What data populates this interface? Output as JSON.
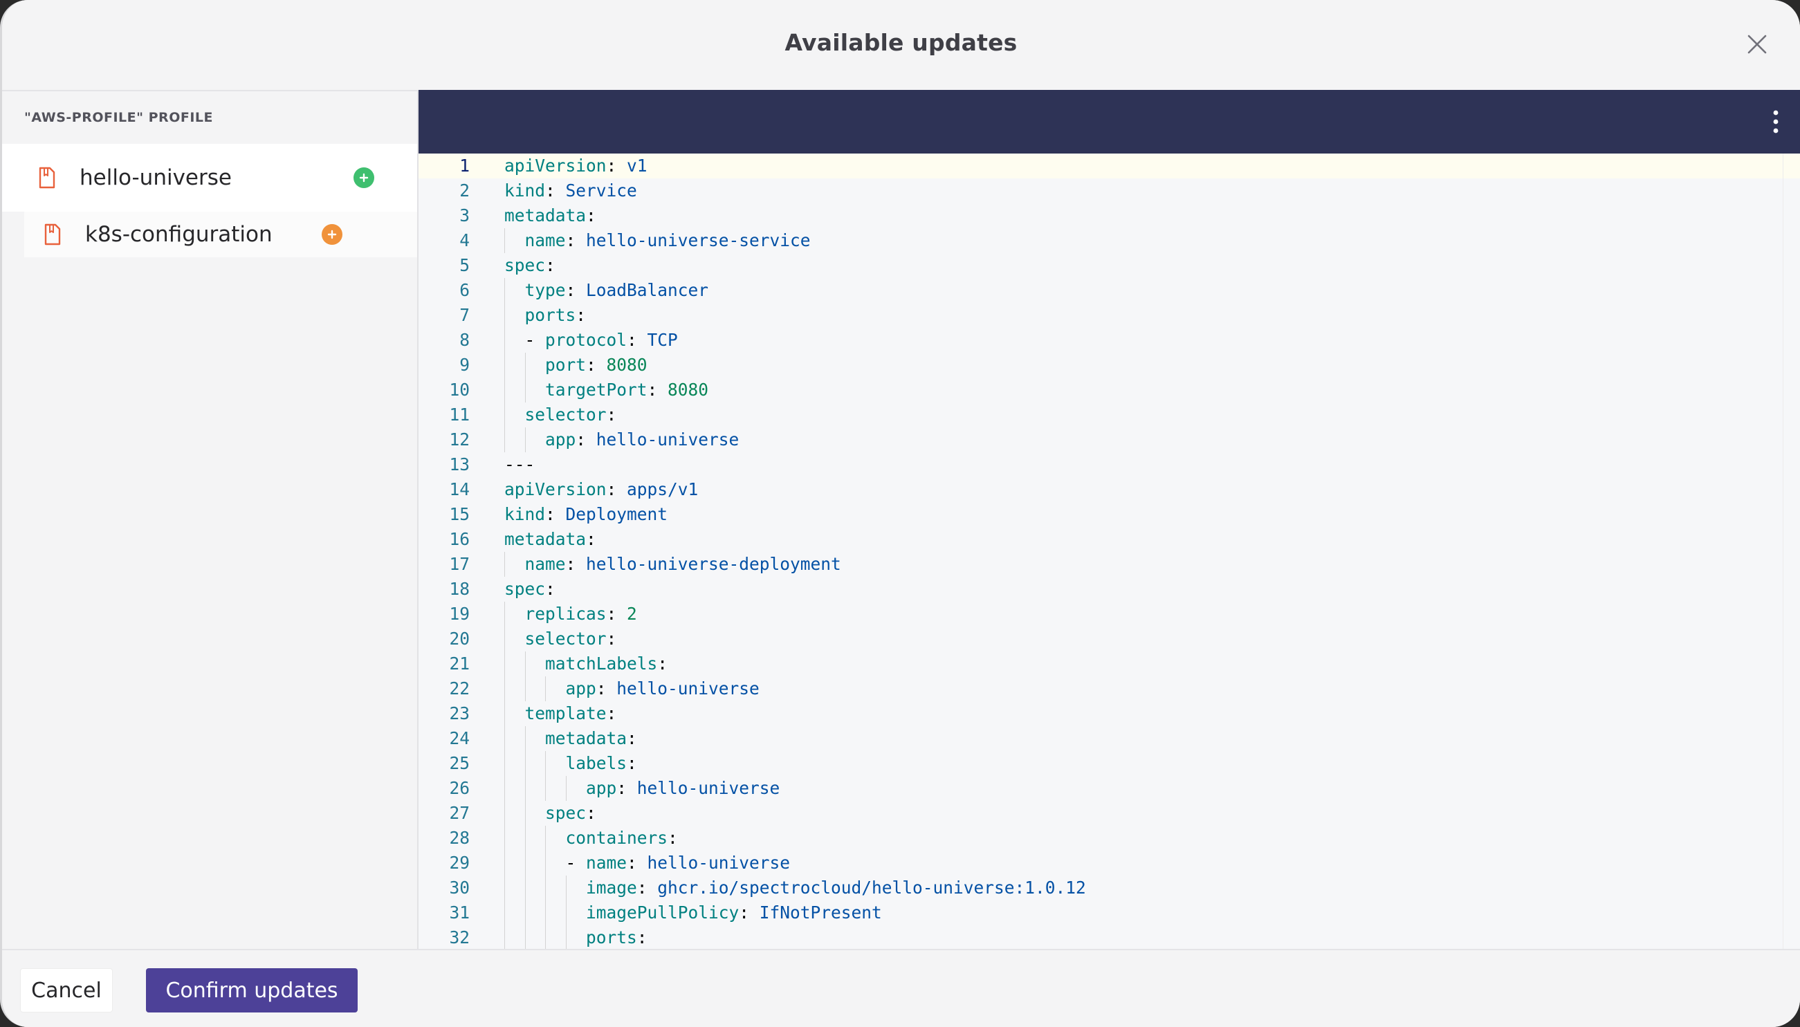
{
  "dialog": {
    "title": "Available updates"
  },
  "sidebar": {
    "section_title": "\"AWS-PROFILE\" PROFILE",
    "items": [
      {
        "label": "hello-universe",
        "badge": "add",
        "badge_color": "#3fbf6f"
      },
      {
        "label": "k8s-configuration",
        "badge": "add",
        "badge_color": "#f0923b"
      }
    ]
  },
  "editor": {
    "lines": [
      {
        "n": "1",
        "d": 0,
        "t": [
          [
            "k",
            "apiVersion"
          ],
          [
            "p",
            ": "
          ],
          [
            "s",
            "v1"
          ]
        ]
      },
      {
        "n": "2",
        "d": 0,
        "t": [
          [
            "k",
            "kind"
          ],
          [
            "p",
            ": "
          ],
          [
            "s",
            "Service"
          ]
        ]
      },
      {
        "n": "3",
        "d": 0,
        "t": [
          [
            "k",
            "metadata"
          ],
          [
            "p",
            ":"
          ]
        ]
      },
      {
        "n": "4",
        "d": 1,
        "t": [
          [
            "k",
            "name"
          ],
          [
            "p",
            ": "
          ],
          [
            "s",
            "hello-universe-service"
          ]
        ]
      },
      {
        "n": "5",
        "d": 0,
        "t": [
          [
            "k",
            "spec"
          ],
          [
            "p",
            ":"
          ]
        ]
      },
      {
        "n": "6",
        "d": 1,
        "t": [
          [
            "k",
            "type"
          ],
          [
            "p",
            ": "
          ],
          [
            "s",
            "LoadBalancer"
          ]
        ]
      },
      {
        "n": "7",
        "d": 1,
        "t": [
          [
            "k",
            "ports"
          ],
          [
            "p",
            ":"
          ]
        ]
      },
      {
        "n": "8",
        "d": 1,
        "t": [
          [
            "p",
            "- "
          ],
          [
            "k",
            "protocol"
          ],
          [
            "p",
            ": "
          ],
          [
            "s",
            "TCP"
          ]
        ]
      },
      {
        "n": "9",
        "d": 2,
        "t": [
          [
            "k",
            "port"
          ],
          [
            "p",
            ": "
          ],
          [
            "n",
            "8080"
          ]
        ]
      },
      {
        "n": "10",
        "d": 2,
        "t": [
          [
            "k",
            "targetPort"
          ],
          [
            "p",
            ": "
          ],
          [
            "n",
            "8080"
          ]
        ]
      },
      {
        "n": "11",
        "d": 1,
        "t": [
          [
            "k",
            "selector"
          ],
          [
            "p",
            ":"
          ]
        ]
      },
      {
        "n": "12",
        "d": 2,
        "t": [
          [
            "k",
            "app"
          ],
          [
            "p",
            ": "
          ],
          [
            "s",
            "hello-universe"
          ]
        ]
      },
      {
        "n": "13",
        "d": 0,
        "t": [
          [
            "p",
            "---"
          ]
        ]
      },
      {
        "n": "14",
        "d": 0,
        "t": [
          [
            "k",
            "apiVersion"
          ],
          [
            "p",
            ": "
          ],
          [
            "s",
            "apps/v1"
          ]
        ]
      },
      {
        "n": "15",
        "d": 0,
        "t": [
          [
            "k",
            "kind"
          ],
          [
            "p",
            ": "
          ],
          [
            "s",
            "Deployment"
          ]
        ]
      },
      {
        "n": "16",
        "d": 0,
        "t": [
          [
            "k",
            "metadata"
          ],
          [
            "p",
            ":"
          ]
        ]
      },
      {
        "n": "17",
        "d": 1,
        "t": [
          [
            "k",
            "name"
          ],
          [
            "p",
            ": "
          ],
          [
            "s",
            "hello-universe-deployment"
          ]
        ]
      },
      {
        "n": "18",
        "d": 0,
        "t": [
          [
            "k",
            "spec"
          ],
          [
            "p",
            ":"
          ]
        ]
      },
      {
        "n": "19",
        "d": 1,
        "t": [
          [
            "k",
            "replicas"
          ],
          [
            "p",
            ": "
          ],
          [
            "n",
            "2"
          ]
        ]
      },
      {
        "n": "20",
        "d": 1,
        "t": [
          [
            "k",
            "selector"
          ],
          [
            "p",
            ":"
          ]
        ]
      },
      {
        "n": "21",
        "d": 2,
        "t": [
          [
            "k",
            "matchLabels"
          ],
          [
            "p",
            ":"
          ]
        ]
      },
      {
        "n": "22",
        "d": 3,
        "t": [
          [
            "k",
            "app"
          ],
          [
            "p",
            ": "
          ],
          [
            "s",
            "hello-universe"
          ]
        ]
      },
      {
        "n": "23",
        "d": 1,
        "t": [
          [
            "k",
            "template"
          ],
          [
            "p",
            ":"
          ]
        ]
      },
      {
        "n": "24",
        "d": 2,
        "t": [
          [
            "k",
            "metadata"
          ],
          [
            "p",
            ":"
          ]
        ]
      },
      {
        "n": "25",
        "d": 3,
        "t": [
          [
            "k",
            "labels"
          ],
          [
            "p",
            ":"
          ]
        ]
      },
      {
        "n": "26",
        "d": 4,
        "t": [
          [
            "k",
            "app"
          ],
          [
            "p",
            ": "
          ],
          [
            "s",
            "hello-universe"
          ]
        ]
      },
      {
        "n": "27",
        "d": 2,
        "t": [
          [
            "k",
            "spec"
          ],
          [
            "p",
            ":"
          ]
        ]
      },
      {
        "n": "28",
        "d": 3,
        "t": [
          [
            "k",
            "containers"
          ],
          [
            "p",
            ":"
          ]
        ]
      },
      {
        "n": "29",
        "d": 3,
        "t": [
          [
            "p",
            "- "
          ],
          [
            "k",
            "name"
          ],
          [
            "p",
            ": "
          ],
          [
            "s",
            "hello-universe"
          ]
        ]
      },
      {
        "n": "30",
        "d": 4,
        "t": [
          [
            "k",
            "image"
          ],
          [
            "p",
            ": "
          ],
          [
            "s",
            "ghcr.io/spectrocloud/hello-universe:1.0.12"
          ]
        ]
      },
      {
        "n": "31",
        "d": 4,
        "t": [
          [
            "k",
            "imagePullPolicy"
          ],
          [
            "p",
            ": "
          ],
          [
            "s",
            "IfNotPresent"
          ]
        ]
      },
      {
        "n": "32",
        "d": 4,
        "t": [
          [
            "k",
            "ports"
          ],
          [
            "p",
            ":"
          ]
        ]
      }
    ]
  },
  "footer": {
    "cancel_label": "Cancel",
    "confirm_label": "Confirm updates"
  },
  "colors": {
    "accent": "#4d4198",
    "editor_bar": "#2e3356",
    "file_icon": "#e8613c"
  }
}
